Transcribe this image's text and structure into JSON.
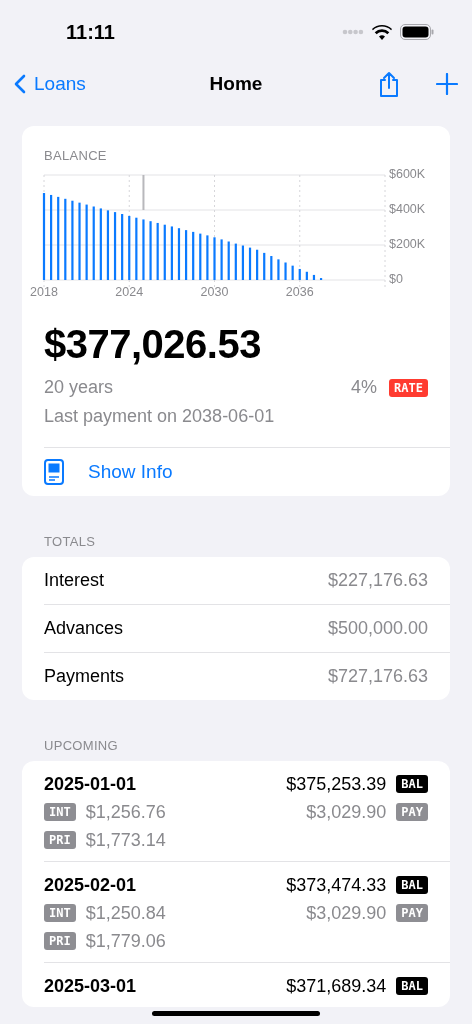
{
  "status_bar": {
    "time": "11:11"
  },
  "nav": {
    "back": "Loans",
    "title": "Home"
  },
  "balance_card": {
    "label": "BALANCE",
    "chart_data": {
      "type": "bar",
      "x": [
        2018,
        2018.5,
        2019,
        2019.5,
        2020,
        2020.5,
        2021,
        2021.5,
        2022,
        2022.5,
        2023,
        2023.5,
        2024,
        2024.5,
        2025,
        2025.5,
        2026,
        2026.5,
        2027,
        2027.5,
        2028,
        2028.5,
        2029,
        2029.5,
        2030,
        2030.5,
        2031,
        2031.5,
        2032,
        2032.5,
        2033,
        2033.5,
        2034,
        2034.5,
        2035,
        2035.5,
        2036,
        2036.5,
        2037,
        2037.5
      ],
      "series": [
        {
          "color": "#0a7aff",
          "values": [
            497000,
            486000,
            475000,
            464000,
            453000,
            442000,
            431000,
            420000,
            409000,
            398000,
            388000,
            377000,
            366000,
            356000,
            346000,
            336000,
            326000,
            316000,
            306000,
            296000,
            285000,
            275000,
            265000,
            255000,
            244000,
            232000,
            220000,
            208000,
            197000,
            185000,
            173000,
            155000,
            137000,
            118000,
            100000,
            82000,
            63000,
            47000,
            29000,
            11000
          ]
        }
      ],
      "grid": true,
      "xlim": [
        2018,
        2042
      ],
      "ylim": [
        0,
        600000
      ],
      "xticks": [
        2018,
        2024,
        2030,
        2036
      ],
      "yticks": [
        {
          "value": 0,
          "label": "$0"
        },
        {
          "value": 200000,
          "label": "$200K"
        },
        {
          "value": 400000,
          "label": "$400K"
        },
        {
          "value": 600000,
          "label": "$600K"
        }
      ],
      "ref_lines": [
        {
          "axis": "x",
          "value": 2025
        }
      ]
    },
    "amount": "$377,026.53",
    "term": "20 years",
    "rate": "4%",
    "rate_badge": "RATE",
    "last_payment": "Last payment on 2038-06-01",
    "info_link": "Show Info"
  },
  "totals": {
    "header": "TOTALS",
    "rows": [
      {
        "label": "Interest",
        "value": "$227,176.63"
      },
      {
        "label": "Advances",
        "value": "$500,000.00"
      },
      {
        "label": "Payments",
        "value": "$727,176.63"
      }
    ]
  },
  "upcoming": {
    "header": "UPCOMING",
    "rows": [
      {
        "date": "2025-01-01",
        "balance": "$375,253.39",
        "balance_badge": "BAL",
        "interest_badge": "INT",
        "interest": "$1,256.76",
        "payment": "$3,029.90",
        "payment_badge": "PAY",
        "principal_badge": "PRI",
        "principal": "$1,773.14"
      },
      {
        "date": "2025-02-01",
        "balance": "$373,474.33",
        "balance_badge": "BAL",
        "interest_badge": "INT",
        "interest": "$1,250.84",
        "payment": "$3,029.90",
        "payment_badge": "PAY",
        "principal_badge": "PRI",
        "principal": "$1,779.06"
      },
      {
        "date": "2025-03-01",
        "balance": "$371,689.34",
        "balance_badge": "BAL"
      }
    ]
  }
}
